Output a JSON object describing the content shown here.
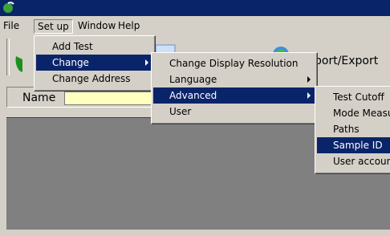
{
  "menubar": {
    "items": [
      {
        "label": "File"
      },
      {
        "label": "Set up"
      },
      {
        "label": "Window"
      },
      {
        "label": "Help"
      }
    ]
  },
  "setup_menu": {
    "items": [
      {
        "label": "Add Test"
      },
      {
        "label": "Change"
      },
      {
        "label": "Change Address"
      }
    ]
  },
  "change_menu": {
    "items": [
      {
        "label": "Change Display Resolution"
      },
      {
        "label": "Language"
      },
      {
        "label": "Advanced"
      },
      {
        "label": "User"
      }
    ]
  },
  "advanced_menu": {
    "items": [
      {
        "label": "Test Cutoff"
      },
      {
        "label": "Mode Measu"
      },
      {
        "label": "Paths"
      },
      {
        "label": "Sample ID"
      },
      {
        "label": "User accoun"
      }
    ]
  },
  "toolbar": {
    "import_export_label": "port/Export"
  },
  "name_row": {
    "label": "Name",
    "value": ""
  },
  "colors": {
    "title_bar": "#0a246a",
    "highlight": "#0a246a",
    "workspace": "#808080",
    "name_field": "#ffffc0"
  }
}
